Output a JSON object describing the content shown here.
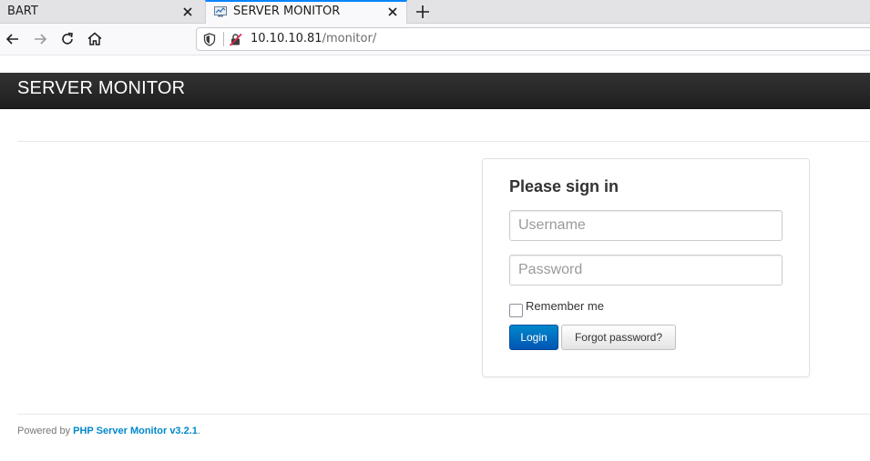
{
  "browser": {
    "tabs": [
      {
        "title": "BART",
        "active": false
      },
      {
        "title": "SERVER MONITOR",
        "active": true
      }
    ],
    "url": {
      "host": "10.10.10.81",
      "path": "/monitor/"
    },
    "accent": "#0a84ff"
  },
  "app": {
    "brand": "SERVER MONITOR",
    "header_color": "#2a2a2a"
  },
  "signin": {
    "heading": "Please sign in",
    "username_placeholder": "Username",
    "password_placeholder": "Password",
    "remember_label": "Remember me",
    "remember_checked": false,
    "login_label": "Login",
    "forgot_label": "Forgot password?",
    "login_color": "#0070c9"
  },
  "footer": {
    "prefix": "Powered by ",
    "link": "PHP Server Monitor v3.2.1",
    "suffix": "."
  }
}
